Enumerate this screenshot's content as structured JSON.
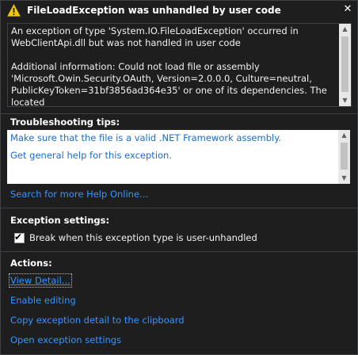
{
  "title": "FileLoadException was unhandled by user code",
  "icons": {
    "warning": "warning-icon",
    "close": "close-icon"
  },
  "message": "An exception of type 'System.IO.FileLoadException' occurred in\nWebClientApi.dll but was not handled in user code\n\nAdditional information: Could not load file or assembly\n'Microsoft.Owin.Security.OAuth, Version=2.0.0.0, Culture=neutral,\nPublicKeyToken=31bf3856ad364e35' or one of its dependencies. The located",
  "troubleshooting": {
    "label": "Troubleshooting tips:",
    "tips": [
      "Make sure that the file is a valid .NET Framework assembly.",
      "Get general help for this exception."
    ],
    "search_link": "Search for more Help Online..."
  },
  "exception_settings": {
    "label": "Exception settings:",
    "checkbox_label": "Break when this exception type is user-unhandled",
    "checked": true
  },
  "actions": {
    "label": "Actions:",
    "items": [
      "View Detail...",
      "Enable editing",
      "Copy exception detail to the clipboard",
      "Open exception settings"
    ]
  },
  "colors": {
    "link": "#3794ff",
    "tip_link": "#1e6cc9",
    "background": "#1e1e1e",
    "warning": "#f2c811"
  }
}
